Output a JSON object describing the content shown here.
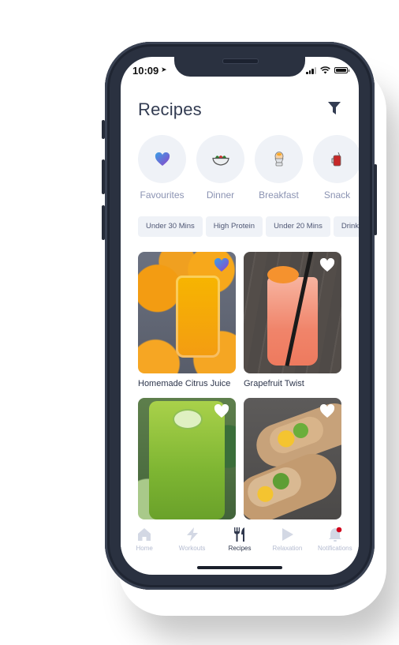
{
  "status_bar": {
    "time": "10:09",
    "icons": [
      "location-arrow-icon",
      "cellular-signal-icon",
      "wifi-icon",
      "battery-icon"
    ]
  },
  "header": {
    "title": "Recipes",
    "filter_icon": "filter-icon"
  },
  "categories": [
    {
      "label": "Favourites",
      "icon": "heart-gradient-icon"
    },
    {
      "label": "Dinner",
      "icon": "salad-bowl-icon"
    },
    {
      "label": "Breakfast",
      "icon": "boiled-egg-icon"
    },
    {
      "label": "Snack",
      "icon": "juice-jar-icon"
    }
  ],
  "filters": [
    "Under 30 Mins",
    "High Protein",
    "Under 20 Mins",
    "Drinks"
  ],
  "recipes": [
    {
      "title": "Homemade Citrus Juice",
      "favourited": true,
      "image": "orange juice jar with oranges"
    },
    {
      "title": "Grapefruit Twist",
      "favourited": false,
      "image": "grapefruit drink with straw"
    },
    {
      "title": "",
      "favourited": false,
      "image": "green smoothie with cucumber"
    },
    {
      "title": "",
      "favourited": false,
      "image": "chicken mango wrap"
    }
  ],
  "tabbar": {
    "items": [
      {
        "label": "Home",
        "icon": "home-icon",
        "active": false
      },
      {
        "label": "Workouts",
        "icon": "lightning-icon",
        "active": false
      },
      {
        "label": "Recipes",
        "icon": "fork-knife-icon",
        "active": true
      },
      {
        "label": "Relaxation",
        "icon": "play-icon",
        "active": false
      },
      {
        "label": "Notifications",
        "icon": "bell-icon",
        "active": false,
        "badge": true
      }
    ]
  },
  "colors": {
    "accent_dark": "#333c52",
    "muted_text": "#8b93b2",
    "chip_bg": "#eff2f7",
    "badge_red": "#d0021b",
    "favourite_gradient_start": "#3aa0e6",
    "favourite_gradient_end": "#8e44c9"
  }
}
